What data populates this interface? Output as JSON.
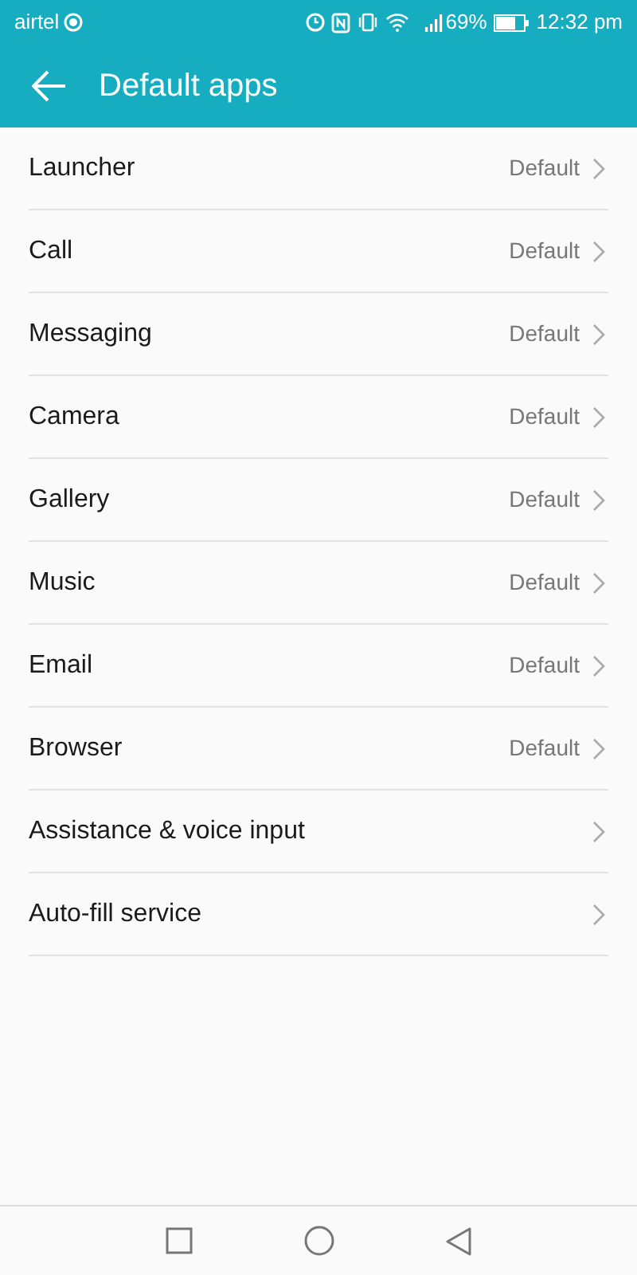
{
  "status_bar": {
    "carrier": "airtel",
    "battery": "69%",
    "time": "12:32 pm"
  },
  "header": {
    "title": "Default apps"
  },
  "items": [
    {
      "label": "Launcher",
      "value": "Default"
    },
    {
      "label": "Call",
      "value": "Default"
    },
    {
      "label": "Messaging",
      "value": "Default"
    },
    {
      "label": "Camera",
      "value": "Default"
    },
    {
      "label": "Gallery",
      "value": "Default"
    },
    {
      "label": "Music",
      "value": "Default"
    },
    {
      "label": "Email",
      "value": "Default"
    },
    {
      "label": "Browser",
      "value": "Default"
    },
    {
      "label": "Assistance & voice input"
    },
    {
      "label": "Auto-fill service"
    }
  ]
}
